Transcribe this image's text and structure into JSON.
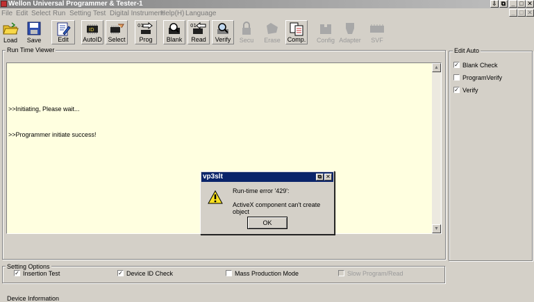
{
  "window": {
    "title": "Wellon Universal Programmer & Tester-1",
    "controls": [
      "⇩",
      "⧉",
      "_",
      "□",
      "✕"
    ]
  },
  "menu": [
    "File",
    "Edit",
    "Select",
    "Run",
    "Setting",
    "Test",
    "Digital Instrument",
    "Help(H)",
    "Language"
  ],
  "toolbar": [
    {
      "label": "Load",
      "icon": "folder-open-icon",
      "enabled": true
    },
    {
      "label": "Save",
      "icon": "floppy-disk-icon",
      "enabled": true
    },
    {
      "label": "Edit",
      "icon": "edit-document-icon",
      "enabled": true
    },
    {
      "label": "AutoID",
      "icon": "chip-id-icon",
      "enabled": true
    },
    {
      "label": "Select",
      "icon": "chip-select-icon",
      "enabled": true
    },
    {
      "label": "Prog",
      "icon": "chip-program-icon",
      "enabled": true
    },
    {
      "label": "Blank",
      "icon": "chip-blank-icon",
      "enabled": true
    },
    {
      "label": "Read",
      "icon": "chip-read-icon",
      "enabled": true
    },
    {
      "label": "Verify",
      "icon": "magnifier-icon",
      "enabled": true
    },
    {
      "label": "Secu",
      "icon": "lock-icon",
      "enabled": false
    },
    {
      "label": "Erase",
      "icon": "eraser-icon",
      "enabled": false
    },
    {
      "label": "Comp.",
      "icon": "compare-document-icon",
      "enabled": true
    },
    {
      "label": "Config",
      "icon": "config-icon",
      "enabled": false
    },
    {
      "label": "Adapter",
      "icon": "adapter-icon",
      "enabled": false
    },
    {
      "label": "SVF",
      "icon": "svf-chip-icon",
      "enabled": false
    }
  ],
  "run_time_viewer": {
    "label": "Run Time Viewer",
    "lines": [
      ">>Initiating, Please wait...",
      ">>Programmer initiate success!"
    ]
  },
  "edit_auto": {
    "label": "Edit Auto",
    "options": [
      {
        "label": "Blank Check",
        "checked": true
      },
      {
        "label": "ProgramVerify",
        "checked": false
      },
      {
        "label": "Verify",
        "checked": true
      }
    ]
  },
  "setting_options": {
    "label": "Setting Options",
    "options": [
      {
        "label": "Insertion Test",
        "checked": true,
        "enabled": true
      },
      {
        "label": "Device ID Check",
        "checked": true,
        "enabled": true
      },
      {
        "label": "Mass Production Mode",
        "checked": false,
        "enabled": true
      },
      {
        "label": "Slow Program/Read",
        "checked": false,
        "enabled": false
      }
    ]
  },
  "device_information": {
    "label": "Device Information"
  },
  "dialog": {
    "title": "vp3slt",
    "line1": "Run-time error '429':",
    "line2": "ActiveX component can't create object",
    "ok_label": "OK",
    "icon": "warning-icon"
  }
}
